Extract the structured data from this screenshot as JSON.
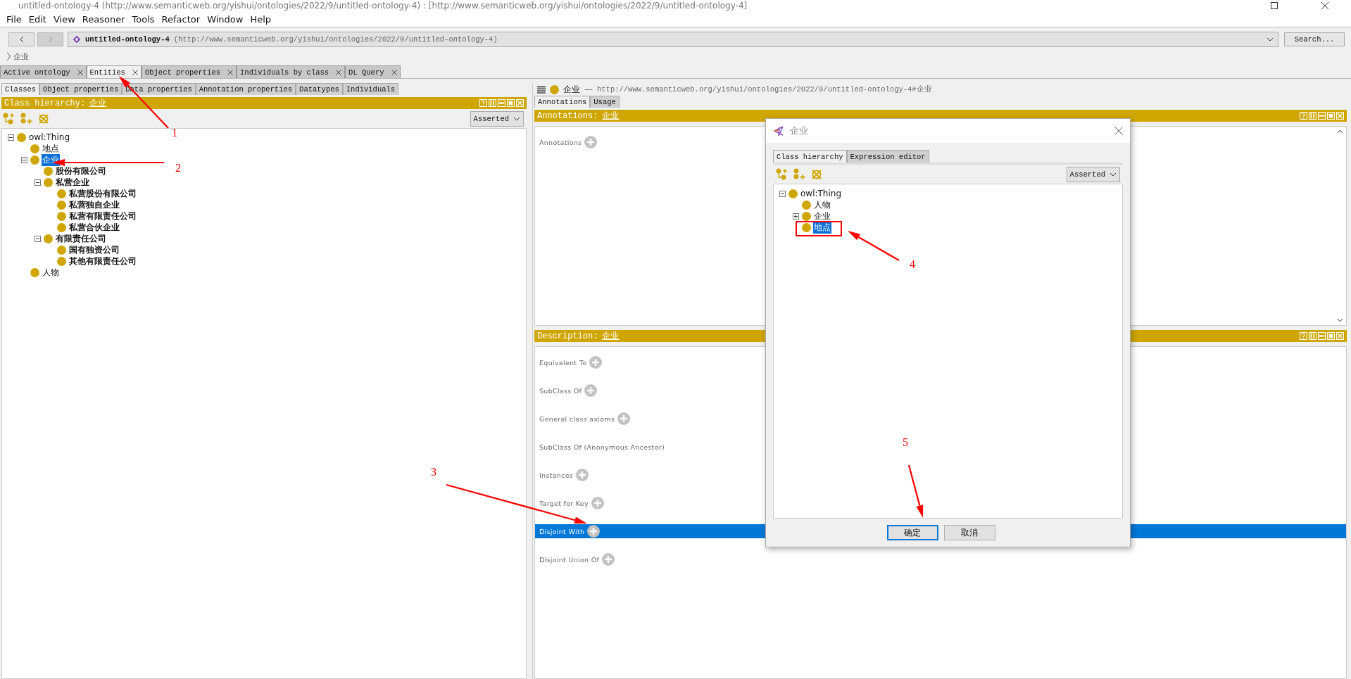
{
  "window": {
    "title": "untitled-ontology-4 (http://www.semanticweb.org/yishui/ontologies/2022/9/untitled-ontology-4) : [http://www.semanticweb.org/yishui/ontologies/2022/9/untitled-ontology-4]"
  },
  "menu": [
    "File",
    "Edit",
    "View",
    "Reasoner",
    "Tools",
    "Refactor",
    "Window",
    "Help"
  ],
  "nav": {
    "ontology": "untitled-ontology-4",
    "iri": "(http://www.semanticweb.org/yishui/ontologies/2022/9/untitled-ontology-4)",
    "search_button": "Search..."
  },
  "breadcrumb": "企业",
  "workspace_tabs": [
    {
      "label": "Active ontology",
      "selected": false
    },
    {
      "label": "Entities",
      "selected": true
    },
    {
      "label": "Object properties",
      "selected": false
    },
    {
      "label": "Individuals by class",
      "selected": false
    },
    {
      "label": "DL Query",
      "selected": false
    }
  ],
  "left": {
    "tabs": [
      {
        "label": "Classes",
        "selected": true
      },
      {
        "label": "Object properties",
        "selected": false
      },
      {
        "label": "Data properties",
        "selected": false
      },
      {
        "label": "Annotation properties",
        "selected": false
      },
      {
        "label": "Datatypes",
        "selected": false
      },
      {
        "label": "Individuals",
        "selected": false
      }
    ],
    "header": {
      "label": "Class hierarchy:",
      "entity": "企业"
    },
    "mode": "Asserted",
    "tree": [
      {
        "label": "owl:Thing",
        "selected": false,
        "bold": false,
        "expanded": true,
        "children": [
          {
            "label": "地点",
            "selected": false,
            "bold": false
          },
          {
            "label": "企业",
            "selected": true,
            "bold": false,
            "expanded": true,
            "children": [
              {
                "label": "股份有限公司",
                "selected": false,
                "bold": true
              },
              {
                "label": "私营企业",
                "selected": false,
                "bold": true,
                "expanded": true,
                "children": [
                  {
                    "label": "私营股份有限公司",
                    "selected": false,
                    "bold": true
                  },
                  {
                    "label": "私营独自企业",
                    "selected": false,
                    "bold": true
                  },
                  {
                    "label": "私营有限责任公司",
                    "selected": false,
                    "bold": true
                  },
                  {
                    "label": "私营合伙企业",
                    "selected": false,
                    "bold": true
                  }
                ]
              },
              {
                "label": "有限责任公司",
                "selected": false,
                "bold": true,
                "expanded": true,
                "children": [
                  {
                    "label": "国有独资公司",
                    "selected": false,
                    "bold": true
                  },
                  {
                    "label": "其他有限责任公司",
                    "selected": false,
                    "bold": true
                  }
                ]
              }
            ]
          },
          {
            "label": "人物",
            "selected": false,
            "bold": false
          }
        ]
      }
    ]
  },
  "right": {
    "entity": "企业",
    "separator": "—",
    "iri": "http://www.semanticweb.org/yishui/ontologies/2022/9/untitled-ontology-4#企业",
    "tabs": [
      {
        "label": "Annotations",
        "selected": true
      },
      {
        "label": "Usage",
        "selected": false
      }
    ],
    "annotations": {
      "header_label": "Annotations:",
      "entity": "企业",
      "label": "Annotations"
    },
    "description": {
      "header_label": "Description:",
      "entity": "企业",
      "rows": [
        {
          "label": "Equivalent To",
          "addable": true,
          "selected": false
        },
        {
          "label": "SubClass Of",
          "addable": true,
          "selected": false
        },
        {
          "label": "General class axioms",
          "addable": true,
          "selected": false
        },
        {
          "label": "SubClass Of (Anonymous Ancestor)",
          "addable": false,
          "selected": false
        },
        {
          "label": "Instances",
          "addable": true,
          "selected": false
        },
        {
          "label": "Target for Key",
          "addable": true,
          "selected": false
        },
        {
          "label": "Disjoint With",
          "addable": true,
          "selected": true
        },
        {
          "label": "Disjoint Union Of",
          "addable": true,
          "selected": false
        }
      ]
    }
  },
  "dialog": {
    "title": "企业",
    "tabs": [
      {
        "label": "Class hierarchy",
        "selected": true
      },
      {
        "label": "Expression editor",
        "selected": false
      }
    ],
    "mode": "Asserted",
    "tree": [
      {
        "label": "owl:Thing",
        "selected": false,
        "bold": false,
        "expanded": true,
        "children": [
          {
            "label": "人物",
            "selected": false,
            "bold": false
          },
          {
            "label": "企业",
            "selected": false,
            "bold": false,
            "expanded": false
          },
          {
            "label": "地点",
            "selected": true,
            "bold": false
          }
        ]
      }
    ],
    "buttons": [
      {
        "label": "确定",
        "kind": "primary"
      },
      {
        "label": "取消",
        "kind": "secondary"
      }
    ]
  },
  "callouts": [
    {
      "label": "1"
    },
    {
      "label": "2"
    },
    {
      "label": "3"
    },
    {
      "label": "4"
    },
    {
      "label": "5"
    }
  ]
}
